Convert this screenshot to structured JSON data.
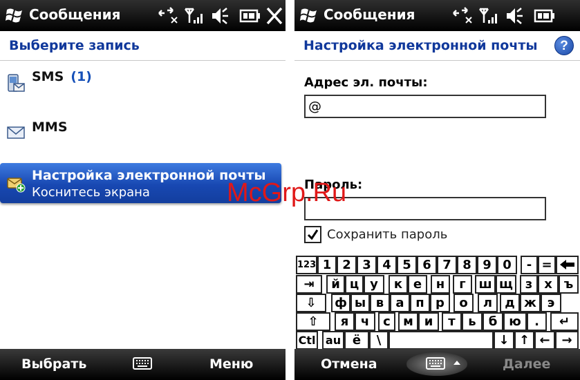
{
  "left_screen": {
    "title": "Сообщения",
    "header": "Выберите запись",
    "items": [
      {
        "label": "SMS",
        "count": "(1)"
      },
      {
        "label": "MMS",
        "count": ""
      },
      {
        "label": "Настройка электронной почты",
        "sublabel": "Коснитесь экрана"
      }
    ],
    "softkeys": {
      "left": "Выбрать",
      "right": "Меню"
    },
    "status_icons": [
      "connectivity-icon",
      "signal-icon",
      "volume-icon",
      "battery-icon",
      "close-icon"
    ]
  },
  "right_screen": {
    "title": "Сообщения",
    "header": "Настройка электронной почты",
    "help": "?",
    "email_label": "Адрес эл. почты:",
    "email_value": "@",
    "password_label": "Пароль:",
    "password_value": "",
    "save_password_label": "Сохранить пароль",
    "save_password_checked": true,
    "softkeys": {
      "left": "Отмена",
      "right": "Далее"
    },
    "keyboard": {
      "rows": [
        [
          "123",
          "1",
          "2",
          "3",
          "4",
          "5",
          "6",
          "7",
          "8",
          "9",
          "0",
          "-",
          "=",
          "◆"
        ],
        [
          "⇥",
          "й",
          "ц",
          "у",
          "к",
          "е",
          "н",
          "г",
          "ш",
          "щ",
          "з",
          "х",
          "ъ"
        ],
        [
          "⇩",
          "ф",
          "ы",
          "в",
          "а",
          "п",
          "р",
          "о",
          "л",
          "д",
          "ж",
          "э"
        ],
        [
          "⇧",
          "я",
          "ч",
          "с",
          "м",
          "и",
          "т",
          "ь",
          "б",
          "ю",
          ".",
          "↵"
        ],
        [
          "Ctl",
          "au",
          "ё",
          "\\",
          "",
          "↓",
          "↑",
          "←",
          "→"
        ]
      ]
    }
  },
  "watermark": "McGrp.Ru",
  "colors": {
    "accent": "#10389b",
    "selection": "#1848b2",
    "watermark": "#e01818"
  }
}
